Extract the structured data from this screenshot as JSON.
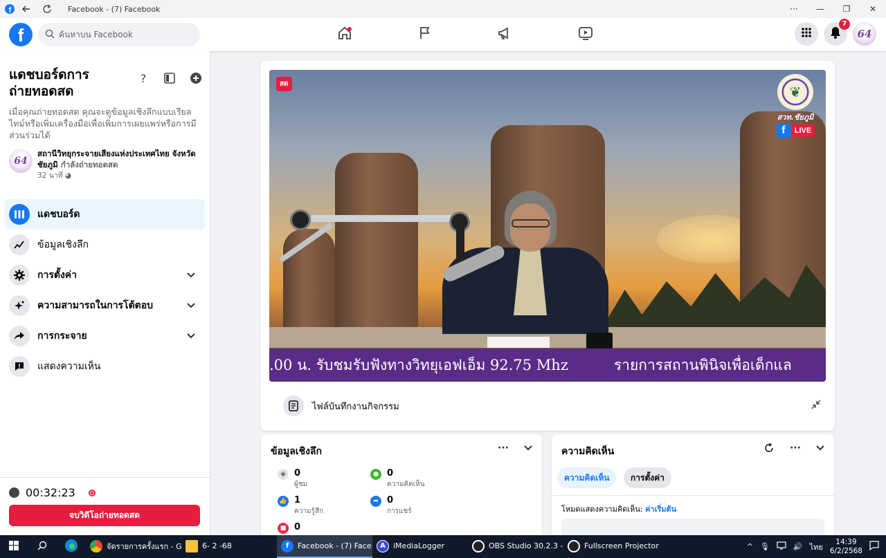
{
  "window": {
    "title": "Facebook - (7) Facebook",
    "controls": [
      "···",
      "—",
      "❐",
      "✕"
    ]
  },
  "header": {
    "search_placeholder": "ค้นหาบน Facebook",
    "notification_count": "7",
    "avatar_text": "64"
  },
  "sidebar": {
    "heading": "แดชบอร์ดการถ่ายทอดสด",
    "description": "เมื่อคุณถ่ายทอดสด คุณจะดูข้อมูลเชิงลึกแบบเรียลไทม์หรือเพิ่มเครื่องมือเพื่อเพิ่มการเผยแพร่หรือการมีส่วนร่วมได้",
    "station_name": "สถานีวิทยุกระจายเสียงแห่งประเทศไทย จังหวัดชัยภูมิ",
    "station_status": "กำลังถ่ายทอดสด",
    "station_time": "32 นาที",
    "menu": [
      {
        "label": "แดชบอร์ด"
      },
      {
        "label": "ข้อมูลเชิงลึก"
      },
      {
        "label": "การตั้งค่า"
      },
      {
        "label": "ความสามารถในการโต้ตอบ"
      },
      {
        "label": "การกระจาย"
      },
      {
        "label": "แสดงความเห็น"
      }
    ],
    "timer": "00:32:23",
    "end_button": "จบวิดีโอถ่ายทอดสด"
  },
  "video": {
    "live_tag": "สด",
    "station_logo_text": "สวท.ชัยภูมิ",
    "fb_live_text": "LIVE",
    "ticker_text_1": ".00 น. รับชมรับฟังทางวิทยุเอฟเอ็ม 92.75 Mhz",
    "ticker_text_2": "รายการสถานพินิจเพื่อเด็กแล",
    "footer_label": "ไฟล์บันทึกงานกิจกรรม"
  },
  "insights": {
    "title": "ข้อมูลเชิงลึก",
    "stats": [
      {
        "value": "0",
        "label": "ผู้ชม",
        "color": "#e4e6eb"
      },
      {
        "value": "0",
        "label": "ความคิดเห็น",
        "color": "#42b72a"
      },
      {
        "value": "1",
        "label": "ความรู้สึก",
        "color": "#1877f2"
      },
      {
        "value": "0",
        "label": "การแชร์",
        "color": "#1877f2"
      },
      {
        "value": "0",
        "label": "",
        "color": "#f02849"
      }
    ]
  },
  "comments": {
    "title": "ความคิดเห็น",
    "tab_comments": "ความคิดเห็น",
    "tab_settings": "การตั้งค่า",
    "mode_label": "โหมดแสดงความคิดเห็น:",
    "mode_value": "ค่าเริ่มต้น"
  },
  "taskbar": {
    "tasks": [
      {
        "label": "จัดรายการครั้งแรก - G...",
        "icon_color": "#4285f4"
      },
      {
        "label": "6- 2 -68",
        "icon_color": "#f6c342"
      },
      {
        "label": "Facebook - (7) Face...",
        "icon_color": "#1877f2"
      },
      {
        "label": "iMediaLogger",
        "icon_color": "#3b4bd8"
      },
      {
        "label": "OBS Studio 30.2.3 - ...",
        "icon_color": "#222222"
      },
      {
        "label": "Fullscreen Projector...",
        "icon_color": "#222222"
      }
    ],
    "lang": "ไทย",
    "time": "14:39",
    "date": "6/2/2568"
  }
}
